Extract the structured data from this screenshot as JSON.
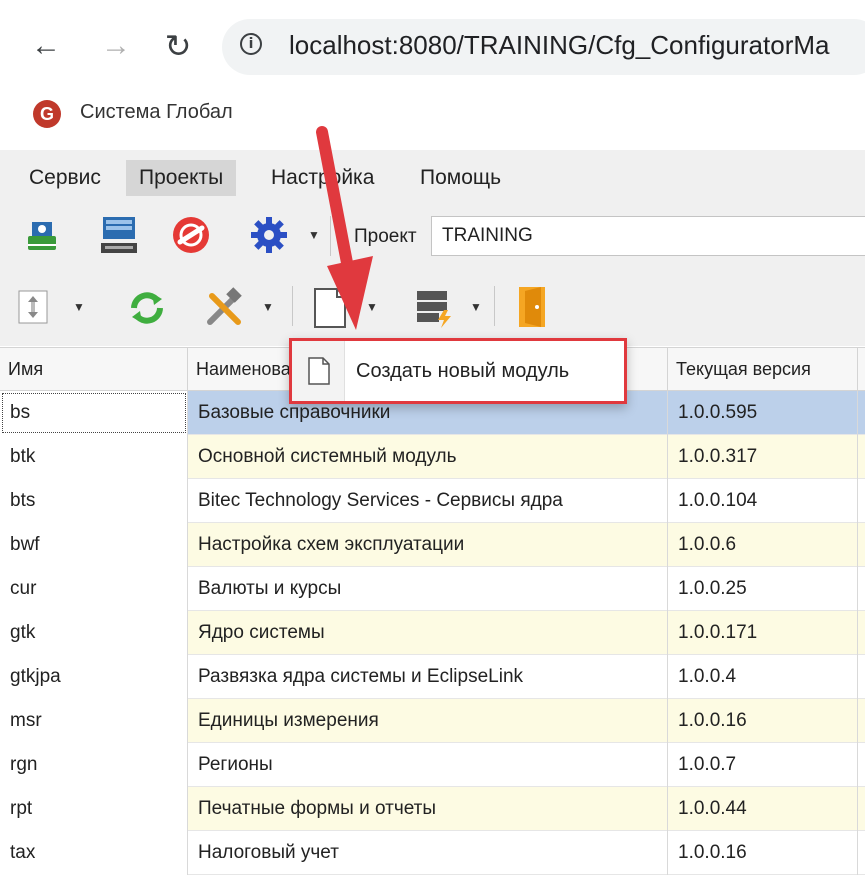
{
  "browser": {
    "back_icon": "arrow-left-icon",
    "forward_icon": "arrow-right-icon",
    "reload_icon": "reload-icon",
    "info_icon": "info-icon",
    "url": "localhost:8080/TRAINING/Cfg_ConfiguratorMa"
  },
  "app": {
    "logo_letter": "G",
    "name": "Система Глобал"
  },
  "menu": {
    "items": [
      {
        "label": "Сервис"
      },
      {
        "label": "Проекты",
        "active": true
      },
      {
        "label": "Настройка"
      },
      {
        "label": "Помощь"
      }
    ]
  },
  "toolbar": {
    "project_label": "Проект",
    "project_value": "TRAINING",
    "icons_row1": [
      "install-icon",
      "network-icon",
      "no-connection-icon",
      "settings-gear-icon"
    ],
    "icons_row2": [
      "move-updown-icon",
      "refresh-icon",
      "tools-icon",
      "new-document-icon",
      "database-lightning-icon",
      "exit-door-icon"
    ]
  },
  "popup": {
    "icon": "new-document-icon",
    "label": "Создать новый модуль"
  },
  "grid": {
    "columns": [
      "Имя",
      "Наименование",
      "Текущая версия"
    ],
    "rows": [
      {
        "name": "bs",
        "title": "Базовые справочники",
        "version": "1.0.0.595",
        "selected": true
      },
      {
        "name": "btk",
        "title": "Основной системный модуль",
        "version": "1.0.0.317"
      },
      {
        "name": "bts",
        "title": "Bitec Technology Services - Сервисы ядра",
        "version": "1.0.0.104"
      },
      {
        "name": "bwf",
        "title": "Настройка схем эксплуатации",
        "version": "1.0.0.6"
      },
      {
        "name": "cur",
        "title": "Валюты и курсы",
        "version": "1.0.0.25"
      },
      {
        "name": "gtk",
        "title": "Ядро системы",
        "version": "1.0.0.171"
      },
      {
        "name": "gtkjpa",
        "title": "Развязка ядра системы и EclipseLink",
        "version": "1.0.0.4"
      },
      {
        "name": "msr",
        "title": "Единицы измерения",
        "version": "1.0.0.16"
      },
      {
        "name": "rgn",
        "title": "Регионы",
        "version": "1.0.0.7"
      },
      {
        "name": "rpt",
        "title": "Печатные формы и отчеты",
        "version": "1.0.0.44"
      },
      {
        "name": "tax",
        "title": "Налоговый учет",
        "version": "1.0.0.16"
      }
    ]
  },
  "colors": {
    "accent_red": "#e0393e",
    "row_alt": "#fdfbe3",
    "row_selected": "#bcd0ea"
  }
}
